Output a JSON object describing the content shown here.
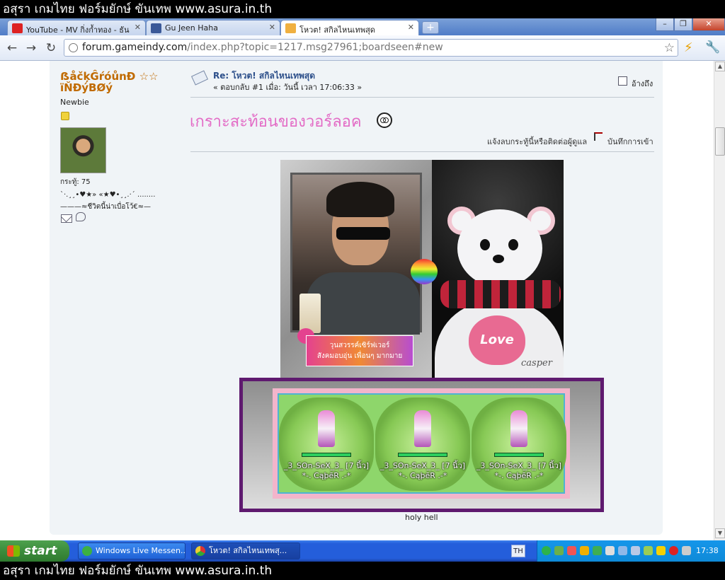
{
  "banner": {
    "text": "อสุรา เกมไทย ฟอร์มยักษ์ ขันเทพ www.asura.in.th"
  },
  "browser": {
    "tabs": [
      {
        "label": "YouTube - MV กิ่งก้ำทอง - ธันว"
      },
      {
        "label": "Gu Jeen Haha"
      },
      {
        "label": "โหวต! สกิลไหนเทพสุด"
      }
    ],
    "url_host": "forum.gameindy.com",
    "url_path": "/index.php?topic=1217.msg27961;boardseen#new"
  },
  "user": {
    "name": "ẞåčķĜŕóůnĐ ☆☆ ïŇĐýBØý",
    "rank": "Newbie",
    "posts": "กระทู้: 75",
    "sig_line1": "`·.¸¸•♥★» «★♥•¸¸.·´ ........",
    "sig_line2": "———≈ชีวิตนี้น่าเบื่อโว้€≈—"
  },
  "post": {
    "title": "Re: โหวต! สกิลไหนเทพสุด",
    "meta": "« ตอบกลับ #1 เมื่อ: วันนี้ เวลา 17:06:33 »",
    "quote_label": "อ้างถึง",
    "heading": "เกราะสะท้อนของวอร์ลอค",
    "report_link": "แจ้งลบกระทู้นี้หรือติดต่อผู้ดูแล",
    "ip_label": "บันทึกการเข้า",
    "caption_line1": "วุนสวรรค์เซิร์ฟเวอร์",
    "caption_line2": "สังคมอบอุ่น เพื่อนๆ มากมาย",
    "love_text": "Love",
    "casper_text": "casper",
    "characters": [
      {
        "name": "_3_SOn-SeX_3_ [7 นิ้ว]",
        "guild": "*-. CąþēR .-*"
      },
      {
        "name": "_3_SOn-SeX_3_ [7 นิ้ว]",
        "guild": "*-. CąþēR .-*"
      },
      {
        "name": "_3_SOn-SeX_3_ [7 นิ้ว]",
        "guild": "*-. CąþēR .-*"
      }
    ],
    "image_caption": "holy hell"
  },
  "taskbar": {
    "start_label": "start",
    "tasks": [
      {
        "label": "Windows Live Messen..."
      },
      {
        "label": "โหวต! สกิลไหนเทพสุ..."
      }
    ],
    "lang": "TH",
    "clock": "17:38"
  },
  "colors": {
    "username": "#c06a00",
    "heading": "#e36cc6",
    "post_title": "#2c4f8a",
    "frame": "#5f1a6f"
  }
}
